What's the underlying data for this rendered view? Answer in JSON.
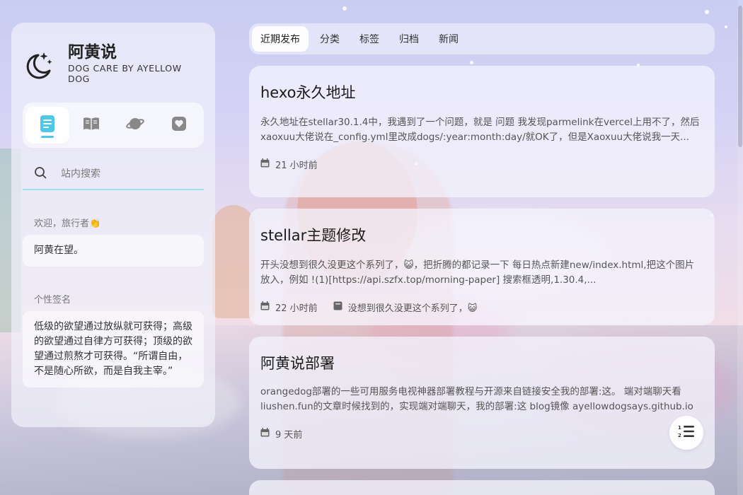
{
  "site": {
    "title": "阿黄说",
    "subtitle": "DOG CARE BY AYELLOW DOG"
  },
  "sidebar": {
    "nav_icons": [
      "posts-icon",
      "wiki-icon",
      "planet-icon",
      "heart-icon"
    ],
    "search": {
      "placeholder": "站内搜索"
    },
    "welcome_label": "欢迎，旅行者👏",
    "welcome_text": "阿黄在望。",
    "signature_label": "个性签名",
    "signature_text": "低级的欲望通过放纵就可获得；高级的欲望通过自律方可获得；顶级的欲望通过煎熬才可获得。“所谓自由，不是随心所欲，而是自我主宰。”"
  },
  "tabs": [
    {
      "label": "近期发布",
      "active": true
    },
    {
      "label": "分类"
    },
    {
      "label": "标签"
    },
    {
      "label": "归档"
    },
    {
      "label": "新闻"
    }
  ],
  "posts": [
    {
      "title": "hexo永久地址",
      "excerpt": "永久地址在stellar30.1.4中，我遇到了一个问题，就是 问题 我发现parmelink在vercel上用不了，然后xaoxuu大佬说在_config.yml里改成dogs/:year:month:day/就OK了，但是Xaoxuu大佬说我一天...",
      "date": "21 小时前"
    },
    {
      "title": "stellar主题修改",
      "excerpt": "开头没想到很久没更这个系列了，😺，把折腾的都记录一下 每日热点新建new/index.html,把这个图片放入，例如 !(1)[https://api.szfx.top/morning-paper] 搜索框透明,1.30.4,...",
      "date": "22 小时前",
      "category": "没想到很久没更这个系列了，😺"
    },
    {
      "title": "阿黄说部署",
      "excerpt": "orangedog部署的一些可用服务电视神器部署教程与开源来自链接安全我的部署:这。 端对端聊天看liushen.fun的文章时候找到的，实现端对端聊天，我的部署:这 blog镜像 ayellowdogsays.github.io",
      "date": "9 天前"
    }
  ],
  "colors": {
    "accent": "#4ec8e6"
  }
}
